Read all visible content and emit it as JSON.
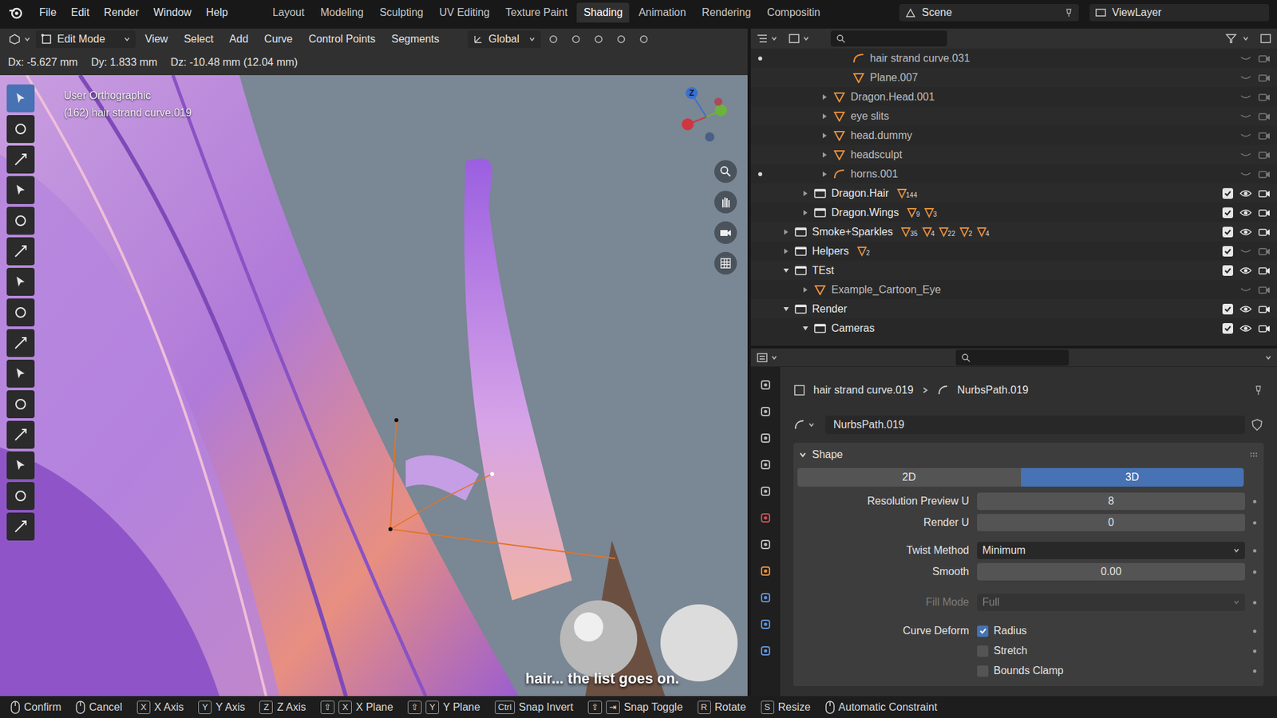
{
  "topbar": {
    "menus": [
      "File",
      "Edit",
      "Render",
      "Window",
      "Help"
    ],
    "workspaces": [
      {
        "label": "Layout",
        "selected": false
      },
      {
        "label": "Modeling",
        "selected": false
      },
      {
        "label": "Sculpting",
        "selected": false
      },
      {
        "label": "UV Editing",
        "selected": false
      },
      {
        "label": "Texture Paint",
        "selected": false
      },
      {
        "label": "Shading",
        "selected": true
      },
      {
        "label": "Animation",
        "selected": false
      },
      {
        "label": "Rendering",
        "selected": false
      },
      {
        "label": "Compositin",
        "selected": false
      }
    ],
    "scene": "Scene",
    "view_layer": "ViewLayer"
  },
  "viewport": {
    "mode": "Edit Mode",
    "menus": [
      "View",
      "Select",
      "Add",
      "Curve",
      "Control Points",
      "Segments"
    ],
    "orientation": "Global",
    "transform_info": [
      "Dx: -5.627 mm",
      "Dy: 1.833 mm",
      "Dz: -10.48 mm (12.04 mm)"
    ],
    "view_name": "User Orthographic",
    "object_label": "(162) hair strand curve.019",
    "gizmo_axis": "Z",
    "tools": [
      {
        "selected": true
      },
      {
        "selected": false
      },
      {
        "selected": false
      },
      {
        "selected": false
      },
      {
        "selected": false
      },
      {
        "selected": false
      },
      {
        "selected": false
      },
      {
        "selected": false
      },
      {
        "selected": false
      },
      {
        "selected": false
      },
      {
        "selected": false
      },
      {
        "selected": false
      },
      {
        "selected": false
      },
      {
        "selected": false
      },
      {
        "selected": false
      }
    ],
    "subtitle": "hair... the list goes on."
  },
  "outliner": {
    "rows": [
      {
        "name": "hair strand curve.031",
        "kind": "curve",
        "depth": 3,
        "has_arrow": false,
        "expanded": false,
        "dot": true,
        "badges": [],
        "checked": true,
        "visible": true
      },
      {
        "name": "Plane.007",
        "kind": "mesh",
        "depth": 3,
        "has_arrow": false,
        "expanded": false,
        "dot": false,
        "badges": [],
        "checked": true,
        "visible": true
      },
      {
        "name": "Dragon.Head.001",
        "kind": "mesh",
        "depth": 2,
        "has_arrow": true,
        "expanded": false,
        "dot": false,
        "badges": [],
        "checked": true,
        "visible": true
      },
      {
        "name": "eye slits",
        "kind": "mesh",
        "depth": 2,
        "has_arrow": true,
        "expanded": false,
        "dot": false,
        "badges": [],
        "checked": true,
        "visible": true
      },
      {
        "name": "head.dummy",
        "kind": "mesh",
        "depth": 2,
        "has_arrow": true,
        "expanded": false,
        "dot": false,
        "badges": [],
        "checked": true,
        "visible": true
      },
      {
        "name": "headsculpt",
        "kind": "mesh",
        "depth": 2,
        "has_arrow": true,
        "expanded": false,
        "dot": false,
        "badges": [],
        "checked": true,
        "visible": true
      },
      {
        "name": "horns.001",
        "kind": "curve",
        "depth": 2,
        "has_arrow": true,
        "expanded": false,
        "dot": true,
        "badges": [],
        "checked": true,
        "visible": true
      },
      {
        "name": "Dragon.Hair",
        "kind": "collection",
        "depth": 1,
        "has_arrow": true,
        "expanded": false,
        "dot": false,
        "badges": [
          "144"
        ],
        "checked": true,
        "visible": true
      },
      {
        "name": "Dragon.Wings",
        "kind": "collection",
        "depth": 1,
        "has_arrow": true,
        "expanded": false,
        "dot": false,
        "badges": [
          "9",
          "3"
        ],
        "checked": true,
        "visible": true
      },
      {
        "name": "Smoke+Sparkles",
        "kind": "collection",
        "depth": 0,
        "has_arrow": true,
        "expanded": false,
        "dot": false,
        "badges": [
          "35",
          "4",
          "22",
          "2",
          "4"
        ],
        "checked": true,
        "visible": true
      },
      {
        "name": "Helpers",
        "kind": "collection",
        "depth": 0,
        "has_arrow": true,
        "expanded": false,
        "dot": false,
        "badges": [
          "2"
        ],
        "checked": true,
        "visible": false
      },
      {
        "name": "TEst",
        "kind": "collection",
        "depth": 0,
        "has_arrow": true,
        "expanded": true,
        "dot": false,
        "badges": [],
        "checked": true,
        "visible": true
      },
      {
        "name": "Example_Cartoon_Eye",
        "kind": "mesh",
        "depth": 1,
        "has_arrow": true,
        "expanded": false,
        "dot": false,
        "badges": [],
        "checked": true,
        "visible": true
      },
      {
        "name": "Render",
        "kind": "collection",
        "depth": 0,
        "has_arrow": true,
        "expanded": true,
        "dot": false,
        "badges": [],
        "checked": true,
        "visible": true
      },
      {
        "name": "Cameras",
        "kind": "collection",
        "depth": 1,
        "has_arrow": true,
        "expanded": true,
        "dot": false,
        "badges": [],
        "checked": true,
        "visible": true
      }
    ]
  },
  "properties": {
    "tabs": [
      {
        "color": "#b8b8b8",
        "selected": false
      },
      {
        "color": "#b8b8b8",
        "selected": false
      },
      {
        "color": "#b8b8b8",
        "selected": false
      },
      {
        "color": "#b8b8b8",
        "selected": false
      },
      {
        "color": "#b8b8b8",
        "selected": false
      },
      {
        "color": "#d05050",
        "selected": false
      },
      {
        "color": "#b8b8b8",
        "selected": false
      },
      {
        "color": "#e8903c",
        "selected": false
      },
      {
        "color": "#5f93db",
        "selected": false
      },
      {
        "color": "#5f93db",
        "selected": false
      },
      {
        "color": "#5f93db",
        "selected": false
      }
    ],
    "object": "hair strand curve.019",
    "data": "NurbsPath.019",
    "datablock": "NurbsPath.019",
    "panel": {
      "title": "Shape",
      "expanded": true
    },
    "dimensions": [
      {
        "label": "2D",
        "selected": false
      },
      {
        "label": "3D",
        "selected": true
      }
    ],
    "fields": [
      {
        "label": "Resolution Preview U",
        "value": "8",
        "kind": "number",
        "disabled": false
      },
      {
        "label": "Render U",
        "value": "0",
        "kind": "number",
        "disabled": false
      },
      {
        "label": "Twist Method",
        "value": "Minimum",
        "kind": "dropdown",
        "disabled": false
      },
      {
        "label": "Smooth",
        "value": "0.00",
        "kind": "number",
        "disabled": false
      },
      {
        "label": "Fill Mode",
        "value": "Full",
        "kind": "dropdown",
        "disabled": true
      }
    ],
    "curve_deform": {
      "label": "Curve Deform",
      "options": [
        {
          "label": "Radius",
          "checked": true
        },
        {
          "label": "Stretch",
          "checked": false
        },
        {
          "label": "Bounds Clamp",
          "checked": false
        }
      ]
    }
  },
  "status_bar": [
    {
      "mouse": true,
      "keys": [],
      "label": "Confirm"
    },
    {
      "mouse": true,
      "keys": [],
      "label": "Cancel"
    },
    {
      "mouse": false,
      "keys": [
        "X"
      ],
      "label": "X Axis"
    },
    {
      "mouse": false,
      "keys": [
        "Y"
      ],
      "label": "Y Axis"
    },
    {
      "mouse": false,
      "keys": [
        "Z"
      ],
      "label": "Z Axis"
    },
    {
      "mouse": false,
      "keys": [
        "⇧",
        "X"
      ],
      "label": "X Plane"
    },
    {
      "mouse": false,
      "keys": [
        "⇧",
        "Y"
      ],
      "label": "Y Plane"
    },
    {
      "mouse": false,
      "keys": [
        "Ctrl"
      ],
      "label": "Snap Invert"
    },
    {
      "mouse": false,
      "keys": [
        "⇧",
        "⇥"
      ],
      "label": "Snap Toggle"
    },
    {
      "mouse": false,
      "keys": [
        "R"
      ],
      "label": "Rotate"
    },
    {
      "mouse": false,
      "keys": [
        "S"
      ],
      "label": "Resize"
    },
    {
      "mouse": true,
      "keys": [],
      "label": "Automatic Constraint"
    }
  ]
}
